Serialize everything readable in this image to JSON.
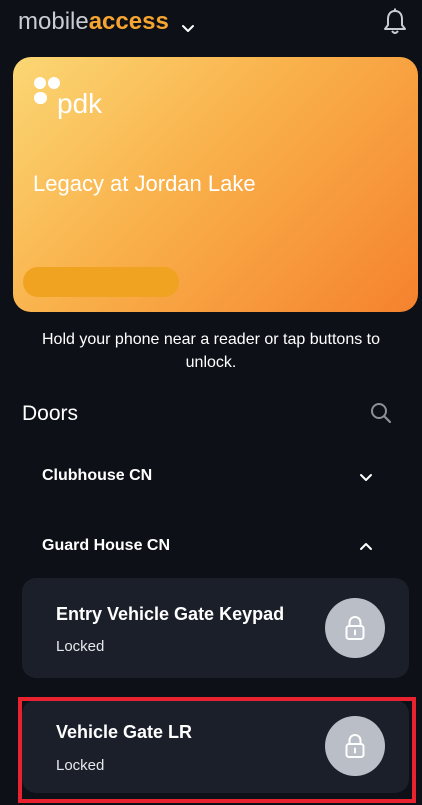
{
  "header": {
    "brand_part1": "mobile",
    "brand_part2": "access"
  },
  "card": {
    "logo_text": "pdk",
    "site_name": "Legacy at Jordan Lake"
  },
  "hint": "Hold your phone near a reader or tap buttons to unlock.",
  "doors_section": {
    "title": "Doors"
  },
  "groups": [
    {
      "name": "Clubhouse CN",
      "state": "collapsed"
    },
    {
      "name": "Guard House CN",
      "state": "expanded"
    }
  ],
  "doors": [
    {
      "name": "Entry Vehicle Gate Keypad",
      "status": "Locked"
    },
    {
      "name": "Vehicle Gate LR",
      "status": "Locked"
    }
  ],
  "colors": {
    "background": "#0d1017",
    "brand_accent": "#f6a531",
    "card_gradient_start": "#fbd774",
    "card_gradient_end": "#f5822e",
    "door_card": "#1b1f29",
    "lock_button": "#b9bec7",
    "highlight": "#e8222f"
  },
  "icons": {
    "brand_dropdown": "chevron-down-icon",
    "notifications": "bell-icon",
    "search": "search-icon",
    "group_collapsed": "chevron-down-icon",
    "group_expanded": "chevron-up-icon",
    "door_action": "padlock-icon"
  }
}
